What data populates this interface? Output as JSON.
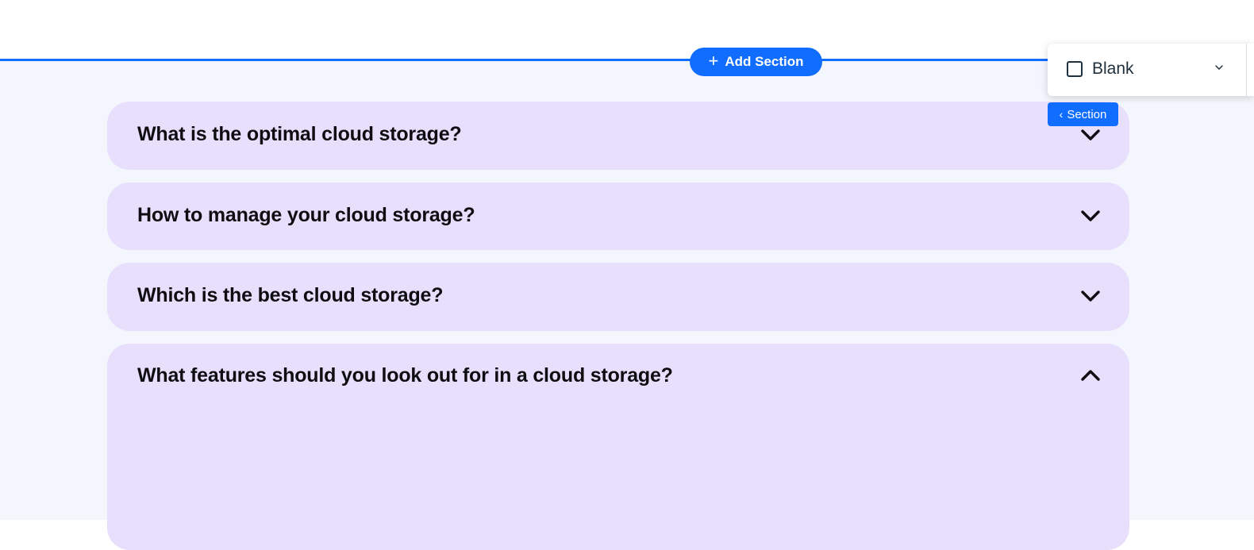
{
  "editor": {
    "add_section_label": "Add Section",
    "add_section_icon": "plus-icon",
    "section_tag_label": "Section",
    "accent_color": "#116dff",
    "layout_panel": {
      "selected_layout": "Blank"
    }
  },
  "faq": {
    "card_color": "#e8dffd",
    "background_color": "#f3f6fd",
    "items": [
      {
        "question": "What is the optimal cloud storage?",
        "expanded": false,
        "icon": "chevron-down-icon"
      },
      {
        "question": "How to manage your cloud storage?",
        "expanded": false,
        "icon": "chevron-down-icon"
      },
      {
        "question": "Which is the best cloud storage?",
        "expanded": false,
        "icon": "chevron-down-icon"
      },
      {
        "question": "What features should you look out for in a cloud storage?",
        "expanded": true,
        "icon": "chevron-up-icon"
      }
    ]
  }
}
